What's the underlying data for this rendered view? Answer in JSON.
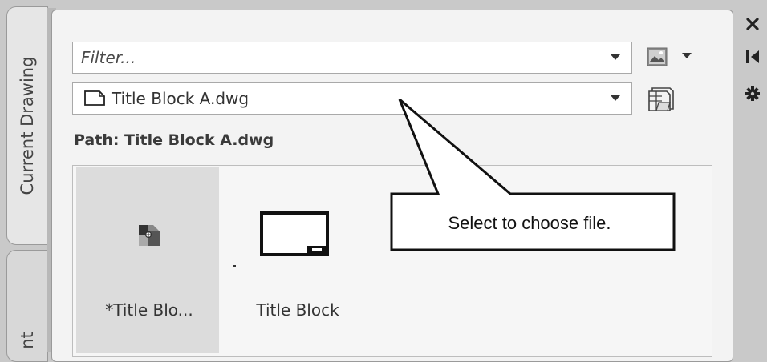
{
  "left_tabs": {
    "current_drawing": "Current Drawing",
    "second_tab_partial": "nt"
  },
  "filter": {
    "placeholder": "Filter..."
  },
  "file_select": {
    "value": "Title Block A.dwg"
  },
  "path_label": "Path: Title Block A.dwg",
  "tiles": [
    {
      "label": "*Title Blo..."
    },
    {
      "label": "Title Block"
    }
  ],
  "callout": {
    "text": "Select to choose file."
  },
  "toolbar_icons": [
    "close-icon",
    "pin-icon",
    "gear-icon"
  ],
  "icons": {
    "file": "file-icon",
    "image": "image-icon",
    "browse": "browse-folder-icon",
    "block": "block-icon",
    "title_block": "title-block-icon"
  }
}
